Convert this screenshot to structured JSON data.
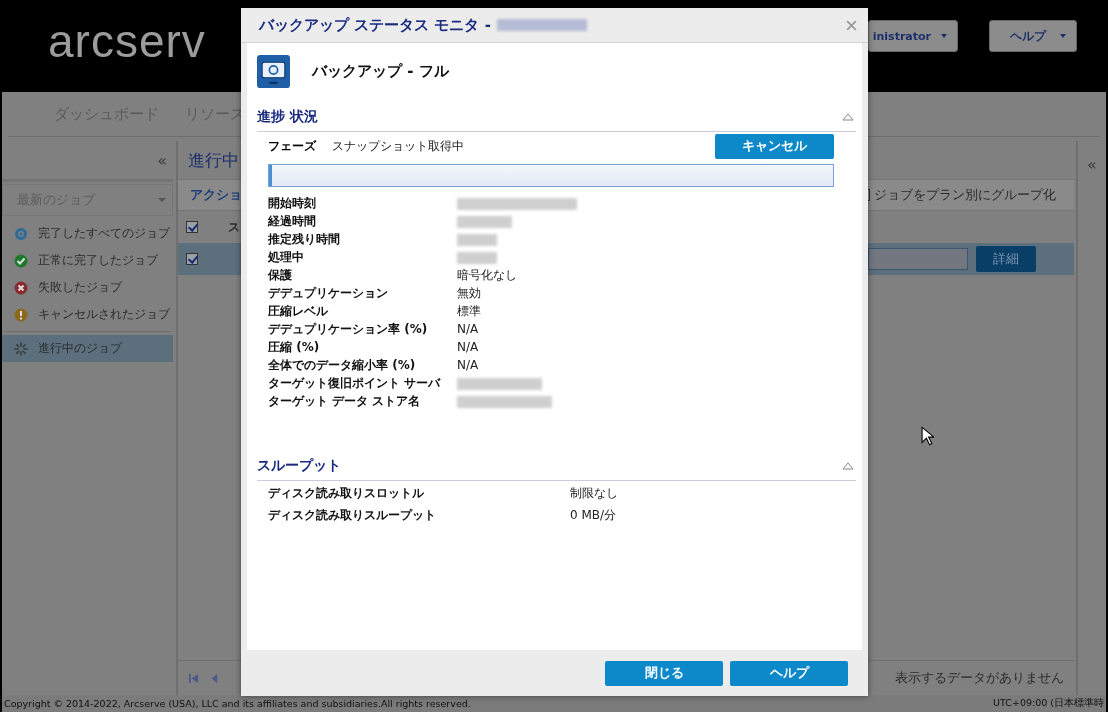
{
  "header": {
    "logo": "arcserv",
    "user_menu": "inistrator",
    "help_menu": "ヘルプ"
  },
  "nav": [
    "ダッシュボード",
    "リソース"
  ],
  "sidebar": {
    "collapse_glyph": "«",
    "filter": {
      "value": "最新のジョブ"
    },
    "items": [
      {
        "label": "完了したすべてのジョブ",
        "kind": "all",
        "selected": false
      },
      {
        "label": "正常に完了したジョブ",
        "kind": "success",
        "selected": false
      },
      {
        "label": "失敗したジョブ",
        "kind": "failed",
        "selected": false
      },
      {
        "label": "キャンセルされたジョブ",
        "kind": "cancelled",
        "selected": false
      },
      {
        "label": "進行中のジョブ",
        "kind": "running",
        "selected": true
      }
    ]
  },
  "jobs_panel": {
    "title": "進行中",
    "toolbar": "アクショ",
    "group_by_plan": {
      "label": "ジョブをプラン別にグループ化",
      "checked": false
    },
    "header_checkbox": {
      "checked": true
    },
    "column_1": "ス",
    "rows": [
      {
        "checked": true,
        "selected": true,
        "detail_button": "詳細"
      }
    ],
    "empty_message": "表示するデータがありません"
  },
  "right_panel": {
    "expand_glyph": "«"
  },
  "dialog": {
    "title": "バックアップ ステータス モニタ -",
    "title_redacted": true,
    "job": "バックアップ - フル",
    "sections": [
      {
        "title": "進捗 状況",
        "expanded": true,
        "phase": {
          "label": "フェーズ",
          "value": "スナップショット取得中"
        },
        "cancel_button": "キャンセル",
        "progress": {
          "level": 0
        },
        "rows": [
          {
            "label": "開始時刻",
            "redacted": true
          },
          {
            "label": "経過時間",
            "redacted": true
          },
          {
            "label": "推定残り時間",
            "redacted": true
          },
          {
            "label": "処理中",
            "redacted": true
          },
          {
            "label": "保護",
            "value": "暗号化なし"
          },
          {
            "label": "デデュプリケーション",
            "value": "無効"
          },
          {
            "label": "圧縮レベル",
            "value": "標準"
          },
          {
            "label": "デデュプリケーション率 (%)",
            "value": "N/A"
          },
          {
            "label": "圧縮 (%)",
            "value": "N/A"
          },
          {
            "label": "全体でのデータ縮小率 (%)",
            "value": "N/A"
          },
          {
            "label": "ターゲット復旧ポイント サーバ",
            "redacted": true
          },
          {
            "label": "ターゲット データ ストア名",
            "redacted": true
          }
        ]
      },
      {
        "title": "スループット",
        "expanded": true,
        "rows": [
          {
            "label": "ディスク読み取りスロットル",
            "value": "制限なし"
          },
          {
            "label": "ディスク読み取りスループット",
            "value": "0 MB/分"
          }
        ]
      }
    ],
    "buttons": [
      "閉じる",
      "ヘルプ"
    ]
  },
  "footer": {
    "copyright": "Copyright © 2014-2022, Arcserve (USA), LLC and its affiliates and subsidiaries.All rights reserved.",
    "timezone": "UTC+09:00 (日本標準時"
  }
}
